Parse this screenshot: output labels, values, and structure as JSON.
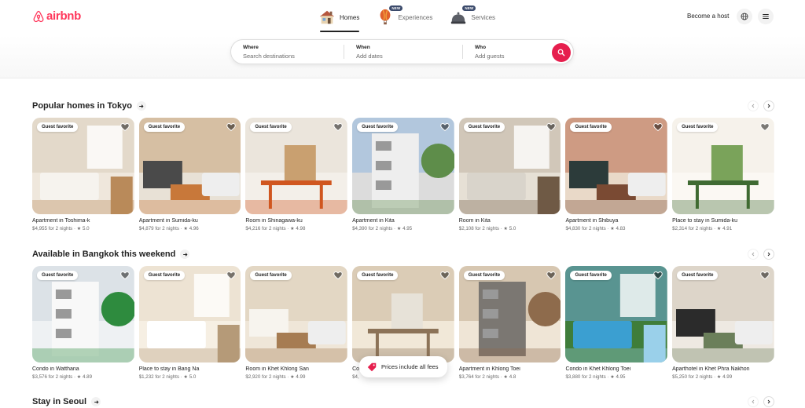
{
  "brand": {
    "name": "airbnb",
    "color": "#ff385c"
  },
  "nav": {
    "items": [
      {
        "label": "Homes",
        "icon": "house-icon",
        "badge": ""
      },
      {
        "label": "Experiences",
        "icon": "hot-air-balloon-icon",
        "badge": "NEW"
      },
      {
        "label": "Services",
        "icon": "service-bell-icon",
        "badge": "NEW"
      }
    ],
    "active": "Homes"
  },
  "header": {
    "host_link": "Become a host",
    "globe_icon": "globe-icon",
    "menu_icon": "hamburger-menu-icon"
  },
  "search": {
    "where": {
      "label": "Where",
      "placeholder": "Search destinations"
    },
    "when": {
      "label": "When",
      "placeholder": "Add dates"
    },
    "who": {
      "label": "Who",
      "placeholder": "Add guests"
    },
    "button_icon": "search-icon",
    "button_color": "#e61e4d"
  },
  "sections": [
    {
      "title": "Popular homes in Tokyo",
      "cards": [
        {
          "badge": "Guest favorite",
          "title": "Apartment in Toshima-k",
          "meta": "$4,955 for 2 nights · ★ 5.0"
        },
        {
          "badge": "Guest favorite",
          "title": "Apartment in Sumida-ku",
          "meta": "$4,879 for 2 nights · ★ 4.96"
        },
        {
          "badge": "Guest favorite",
          "title": "Room in Shinagawa-ku",
          "meta": "$4,216 for 2 nights · ★ 4.98"
        },
        {
          "badge": "Guest favorite",
          "title": "Apartment in Kita",
          "meta": "$4,390 for 2 nights · ★ 4.95"
        },
        {
          "badge": "Guest favorite",
          "title": "Room in Kita",
          "meta": "$2,108 for 2 nights · ★ 5.0"
        },
        {
          "badge": "Guest favorite",
          "title": "Apartment in Shibuya",
          "meta": "$4,830 for 2 nights · ★ 4.83"
        },
        {
          "badge": "Guest favorite",
          "title": "Place to stay in Sumida-ku",
          "meta": "$2,314 for 2 nights · ★ 4.91"
        }
      ]
    },
    {
      "title": "Available in Bangkok this weekend",
      "cards": [
        {
          "badge": "Guest favorite",
          "title": "Condo in Watthana",
          "meta": "$3,576 for 2 nights · ★ 4.89"
        },
        {
          "badge": "Guest favorite",
          "title": "Place to stay in Bang Na",
          "meta": "$1,232 for 2 nights · ★ 5.0"
        },
        {
          "badge": "Guest favorite",
          "title": "Room in Khet Khlong San",
          "meta": "$2,920 for 2 nights · ★ 4.99"
        },
        {
          "badge": "Guest favorite",
          "title": "Co",
          "meta": "$4,"
        },
        {
          "badge": "Guest favorite",
          "title": "Apartment in Khlong Toei",
          "meta": "$3,764 for 2 nights · ★ 4.8"
        },
        {
          "badge": "Guest favorite",
          "title": "Condo in Khet Khlong Toei",
          "meta": "$3,880 for 2 nights · ★ 4.95"
        },
        {
          "badge": "Guest favorite",
          "title": "Aparthotel in Khet Phra Nakhon",
          "meta": "$5,250 for 2 nights · ★ 4.99"
        }
      ]
    },
    {
      "title": "Stay in Seoul",
      "cards": []
    }
  ],
  "toast": {
    "text": "Prices include all fees",
    "icon": "price-tag-icon"
  }
}
